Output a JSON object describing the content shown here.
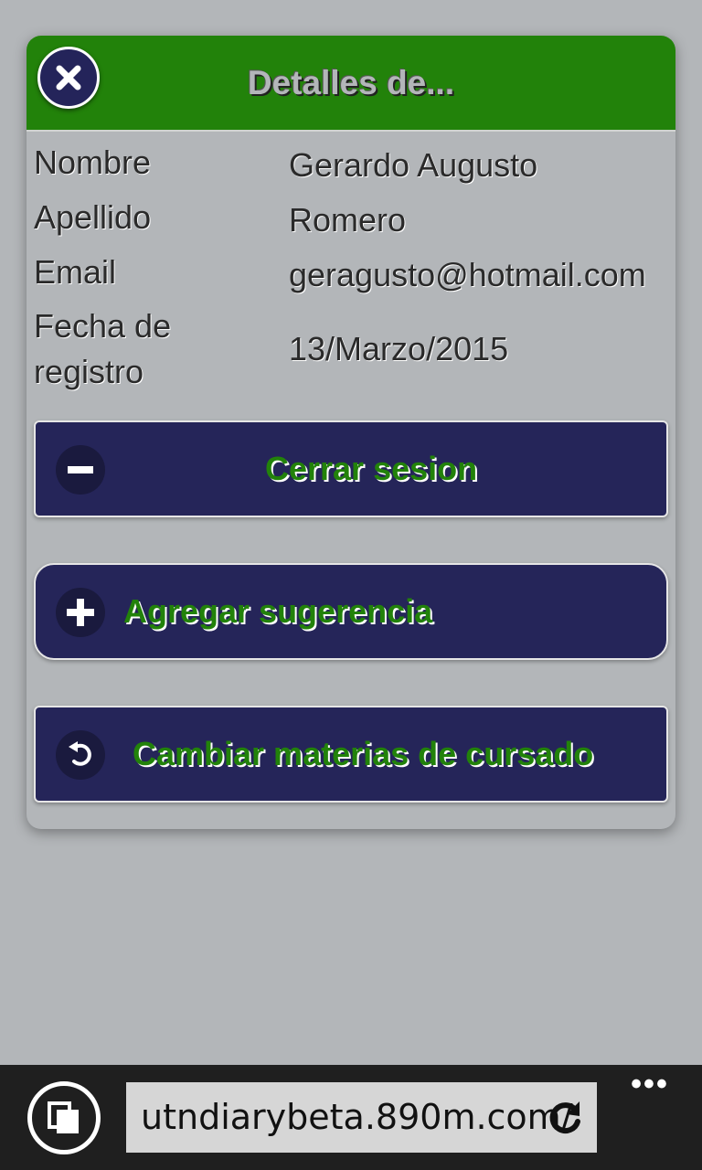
{
  "dialog": {
    "title": "Detalles de...",
    "header_color": "#22820a",
    "close_icon": "close-icon"
  },
  "details": [
    {
      "label": "Nombre",
      "value": "Gerardo Augusto"
    },
    {
      "label": "Apellido",
      "value": "Romero"
    },
    {
      "label": "Email",
      "value": "geragusto@hotmail.com"
    },
    {
      "label": "Fecha de registro",
      "value": "13/Marzo/2015"
    }
  ],
  "buttons": [
    {
      "label": "Cerrar sesion",
      "icon": "minus-icon"
    },
    {
      "label": "Agregar sugerencia",
      "icon": "plus-icon"
    },
    {
      "label": "Cambiar materias de cursado",
      "icon": "back-arrow-icon"
    }
  ],
  "browser": {
    "url": "utndiarybeta.890m.com/",
    "tabs_icon": "tabs-icon",
    "refresh_icon": "refresh-icon",
    "more_label": "•••"
  }
}
